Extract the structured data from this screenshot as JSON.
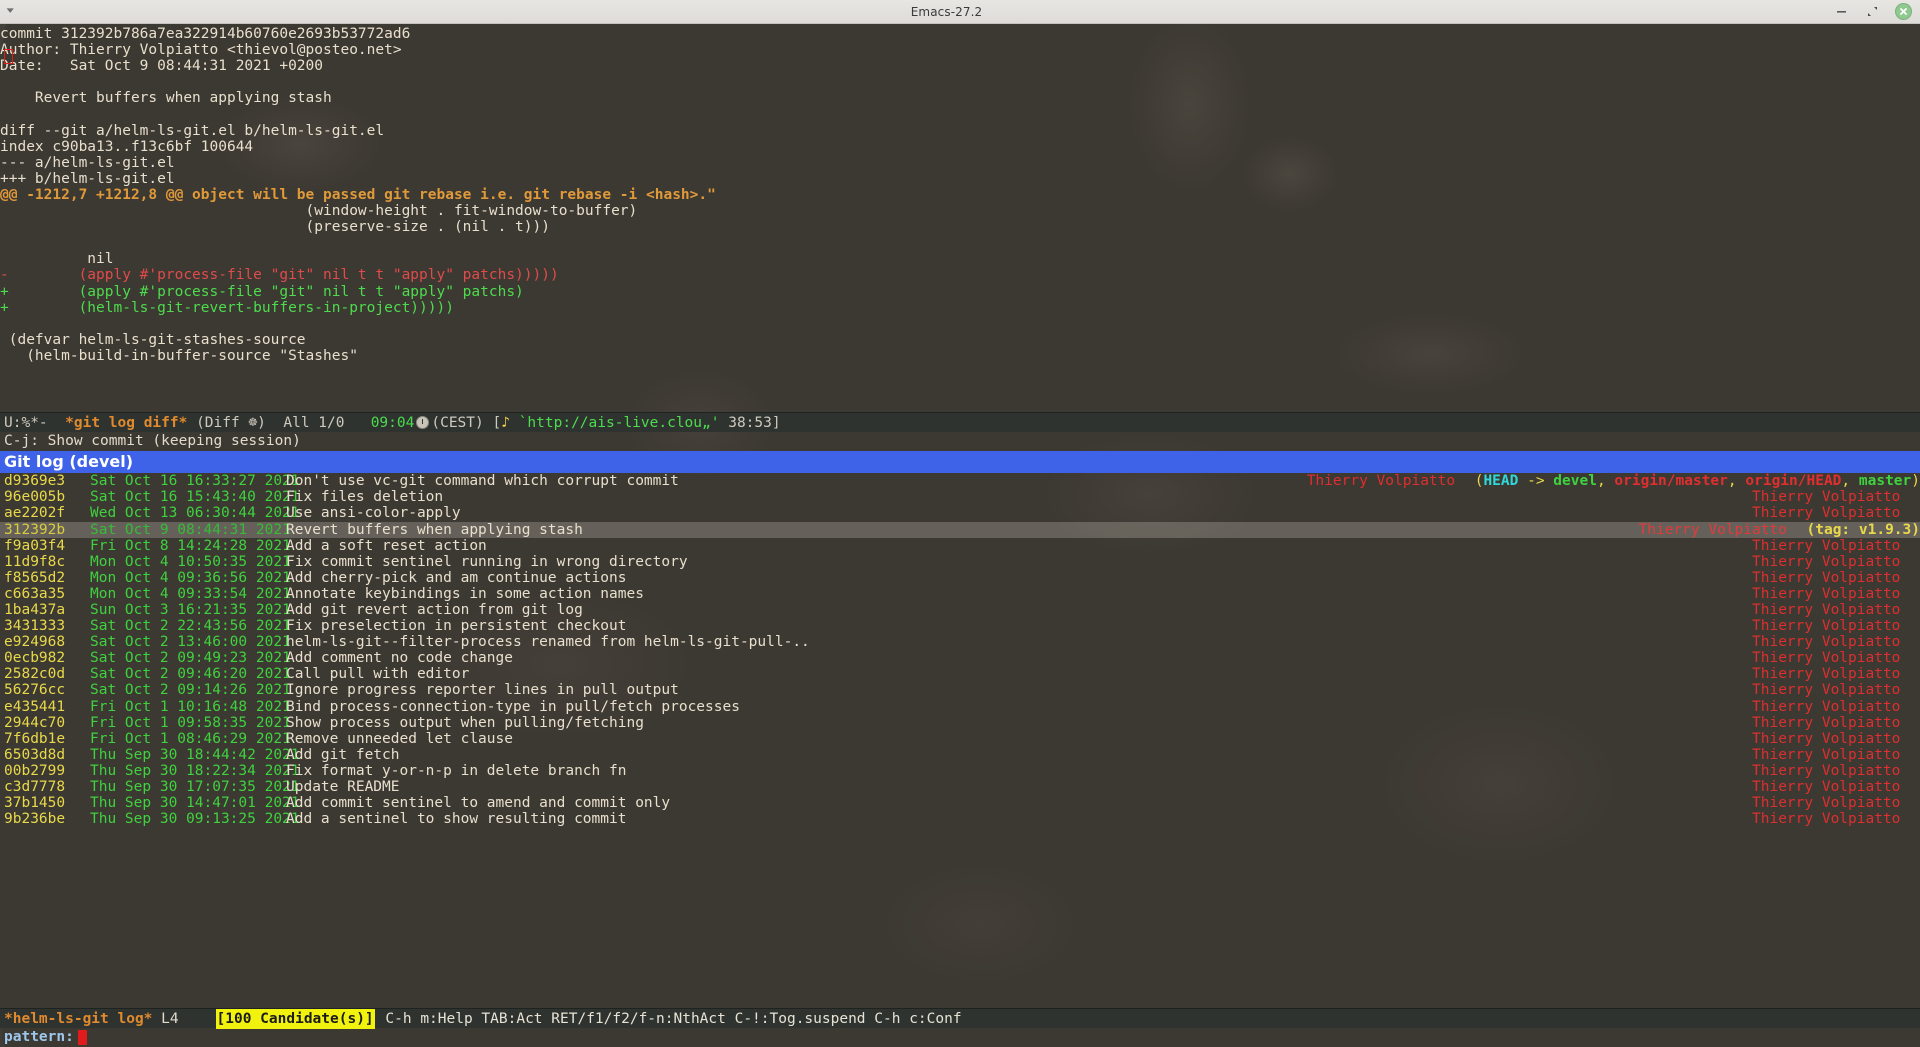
{
  "window": {
    "title": "Emacs-27.2",
    "menu_icon": "app-menu-icon",
    "minimize_label": "Minimize",
    "maximize_label": "Restore",
    "close_label": "Close"
  },
  "diff_buffer": {
    "lines": [
      {
        "text": "commit 312392b786a7ea322914b60760e2693b53772ad6",
        "style": "plain"
      },
      {
        "text": "Author: Thierry Volpiatto <thievol@posteo.net>",
        "style": "plain"
      },
      {
        "text": "Date:   Sat Oct 9 08:44:31 2021 +0200",
        "style": "plain"
      },
      {
        "text": "",
        "style": "plain"
      },
      {
        "text": "    Revert buffers when applying stash",
        "style": "plain"
      },
      {
        "text": "",
        "style": "plain"
      },
      {
        "text": "diff --git a/helm-ls-git.el b/helm-ls-git.el",
        "style": "plain"
      },
      {
        "text": "index c90ba13..f13c6bf 100644",
        "style": "plain"
      },
      {
        "text": "--- a/helm-ls-git.el",
        "style": "plain"
      },
      {
        "text": "+++ b/helm-ls-git.el",
        "style": "plain"
      },
      {
        "text": "@@ -1212,7 +1212,8 @@ object will be passed git rebase i.e. git rebase -i <hash>.\"",
        "style": "hunk"
      },
      {
        "text": "                                   (window-height . fit-window-to-buffer)",
        "style": "plain"
      },
      {
        "text": "                                   (preserve-size . (nil . t)))",
        "style": "plain"
      },
      {
        "text": "",
        "style": "plain"
      },
      {
        "text": "          nil",
        "style": "plain"
      },
      {
        "text": "-        (apply #'process-file \"git\" nil t t \"apply\" patchs)))))",
        "style": "del"
      },
      {
        "text": "+        (apply #'process-file \"git\" nil t t \"apply\" patchs)",
        "style": "add"
      },
      {
        "text": "+        (helm-ls-git-revert-buffers-in-project)))))",
        "style": "add"
      },
      {
        "text": "",
        "style": "plain"
      },
      {
        "text": " (defvar helm-ls-git-stashes-source",
        "style": "plain"
      },
      {
        "text": "   (helm-build-in-buffer-source \"Stashes\"",
        "style": "plain"
      }
    ]
  },
  "modeline": {
    "flags": "U:%*-",
    "buffer": "*git log diff*",
    "major_mode": "(Diff ☸)",
    "position": "All 1/0",
    "time": "09:04",
    "clock_icon": "clock-icon",
    "timezone": "(CEST)",
    "music_icon": "music-note-icon",
    "open_bracket": "[",
    "stream_url": "`http://ais-live.clou„'",
    "stream_time": "38:53]"
  },
  "help_line": {
    "text": "C-j: Show commit (keeping session)"
  },
  "helm": {
    "source_header": "Git log (devel)",
    "columns": [
      "hash",
      "date",
      "subject",
      "author",
      "refs"
    ],
    "candidates": [
      {
        "hash": "d9369e3",
        "date": "Sat Oct 16 16:33:27 2021",
        "subject": "Don't use vc-git command which corrupt commit",
        "author": "Thierry Volpiatto",
        "refs": "(HEAD -> devel, origin/master, origin/HEAD, master)",
        "refs_parts": [
          {
            "t": "(",
            "k": "paren"
          },
          {
            "t": "HEAD",
            "k": "head"
          },
          {
            "t": " -> ",
            "k": "paren"
          },
          {
            "t": "devel",
            "k": "local"
          },
          {
            "t": ", ",
            "k": "paren"
          },
          {
            "t": "origin/master",
            "k": "remote"
          },
          {
            "t": ", ",
            "k": "paren"
          },
          {
            "t": "origin/HEAD",
            "k": "remote"
          },
          {
            "t": ", ",
            "k": "paren"
          },
          {
            "t": "master",
            "k": "local"
          },
          {
            "t": ")",
            "k": "paren"
          }
        ],
        "selected": false
      },
      {
        "hash": "96e005b",
        "date": "Sat Oct 16 15:43:40 2021",
        "subject": "Fix files deletion",
        "author": "Thierry Volpiatto",
        "refs": "",
        "refs_parts": [],
        "selected": false
      },
      {
        "hash": "ae2202f",
        "date": "Wed Oct 13 06:30:44 2021",
        "subject": "Use ansi-color-apply",
        "author": "Thierry Volpiatto",
        "refs": "",
        "refs_parts": [],
        "selected": false
      },
      {
        "hash": "312392b",
        "date": "Sat Oct 9 08:44:31 2021",
        "subject": "Revert buffers when applying stash",
        "author": "Thierry Volpiatto",
        "refs": "(tag: v1.9.3)",
        "refs_parts": [
          {
            "t": "(tag: v1.9.3)",
            "k": "tag"
          }
        ],
        "selected": true
      },
      {
        "hash": "f9a03f4",
        "date": "Fri Oct 8 14:24:28 2021",
        "subject": "Add a soft reset action",
        "author": "Thierry Volpiatto",
        "refs": "",
        "refs_parts": [],
        "selected": false
      },
      {
        "hash": "11d9f8c",
        "date": "Mon Oct 4 10:50:35 2021",
        "subject": "Fix commit sentinel running in wrong directory",
        "author": "Thierry Volpiatto",
        "refs": "",
        "refs_parts": [],
        "selected": false
      },
      {
        "hash": "f8565d2",
        "date": "Mon Oct 4 09:36:56 2021",
        "subject": "Add cherry-pick and am continue actions",
        "author": "Thierry Volpiatto",
        "refs": "",
        "refs_parts": [],
        "selected": false
      },
      {
        "hash": "c663a35",
        "date": "Mon Oct 4 09:33:54 2021",
        "subject": "Annotate keybindings in some action names",
        "author": "Thierry Volpiatto",
        "refs": "",
        "refs_parts": [],
        "selected": false
      },
      {
        "hash": "1ba437a",
        "date": "Sun Oct 3 16:21:35 2021",
        "subject": "Add git revert action from git log",
        "author": "Thierry Volpiatto",
        "refs": "",
        "refs_parts": [],
        "selected": false
      },
      {
        "hash": "3431333",
        "date": "Sat Oct 2 22:43:56 2021",
        "subject": "Fix preselection in persistent checkout",
        "author": "Thierry Volpiatto",
        "refs": "",
        "refs_parts": [],
        "selected": false
      },
      {
        "hash": "e924968",
        "date": "Sat Oct 2 13:46:00 2021",
        "subject": "helm-ls-git--filter-process renamed from helm-ls-git-pull-..",
        "author": "Thierry Volpiatto",
        "refs": "",
        "refs_parts": [],
        "selected": false
      },
      {
        "hash": "0ecb982",
        "date": "Sat Oct 2 09:49:23 2021",
        "subject": "Add comment no code change",
        "author": "Thierry Volpiatto",
        "refs": "",
        "refs_parts": [],
        "selected": false
      },
      {
        "hash": "2582c0d",
        "date": "Sat Oct 2 09:46:20 2021",
        "subject": "Call pull with editor",
        "author": "Thierry Volpiatto",
        "refs": "",
        "refs_parts": [],
        "selected": false
      },
      {
        "hash": "56276cc",
        "date": "Sat Oct 2 09:14:26 2021",
        "subject": "Ignore progress reporter lines in pull output",
        "author": "Thierry Volpiatto",
        "refs": "",
        "refs_parts": [],
        "selected": false
      },
      {
        "hash": "e435441",
        "date": "Fri Oct 1 10:16:48 2021",
        "subject": "Bind process-connection-type in pull/fetch processes",
        "author": "Thierry Volpiatto",
        "refs": "",
        "refs_parts": [],
        "selected": false
      },
      {
        "hash": "2944c70",
        "date": "Fri Oct 1 09:58:35 2021",
        "subject": "Show process output when pulling/fetching",
        "author": "Thierry Volpiatto",
        "refs": "",
        "refs_parts": [],
        "selected": false
      },
      {
        "hash": "7f6db1e",
        "date": "Fri Oct 1 08:46:29 2021",
        "subject": "Remove unneeded let clause",
        "author": "Thierry Volpiatto",
        "refs": "",
        "refs_parts": [],
        "selected": false
      },
      {
        "hash": "6503d8d",
        "date": "Thu Sep 30 18:44:42 2021",
        "subject": "Add git fetch",
        "author": "Thierry Volpiatto",
        "refs": "",
        "refs_parts": [],
        "selected": false
      },
      {
        "hash": "00b2799",
        "date": "Thu Sep 30 18:22:34 2021",
        "subject": "Fix format y-or-n-p in delete branch fn",
        "author": "Thierry Volpiatto",
        "refs": "",
        "refs_parts": [],
        "selected": false
      },
      {
        "hash": "c3d7778",
        "date": "Thu Sep 30 17:07:35 2021",
        "subject": "Update README",
        "author": "Thierry Volpiatto",
        "refs": "",
        "refs_parts": [],
        "selected": false
      },
      {
        "hash": "37b1450",
        "date": "Thu Sep 30 14:47:01 2021",
        "subject": "Add commit sentinel to amend and commit only",
        "author": "Thierry Volpiatto",
        "refs": "",
        "refs_parts": [],
        "selected": false
      },
      {
        "hash": "9b236be",
        "date": "Thu Sep 30 09:13:25 2021",
        "subject": "Add a sentinel to show resulting commit",
        "author": "Thierry Volpiatto",
        "refs": "",
        "refs_parts": [],
        "selected": false
      }
    ]
  },
  "helm_modeline": {
    "buffer": "*helm-ls-git log*",
    "position": "L4",
    "count": "[100 Candidate(s)]",
    "keys": "C-h m:Help TAB:Act RET/f1/f2/f-n:NthAct C-!:Tog.suspend C-h c:Conf"
  },
  "minibuffer": {
    "prompt": "pattern:",
    "value": ""
  },
  "colors": {
    "header_bg": "#3f63e8",
    "selection_bg": "#d7d2c8",
    "modeline_bg": "#2e3330",
    "count_badge_bg": "#f2f20f",
    "add": "#4ddc4d",
    "delete": "#e04b4b",
    "hunk": "#e09a3a",
    "hash": "#e8d94a",
    "date": "#3fd23f",
    "author": "#dd2f2f",
    "cursor": "#e01b1b"
  }
}
